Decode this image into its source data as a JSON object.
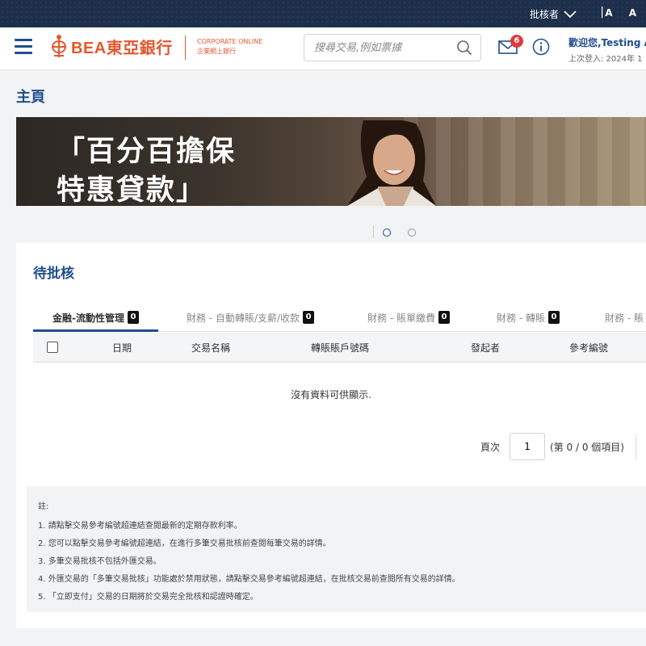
{
  "topbar": {
    "role": "批核者",
    "separator": "|",
    "font_sizes": "A A"
  },
  "header": {
    "logo_text": "BEA東亞銀行",
    "corp_line1": "CORPORATE ONLINE",
    "corp_line2": "企業網上銀行",
    "search_placeholder": "搜尋交易,例如票據",
    "mail_badge": "6",
    "welcome": "歡迎您,Testing AI",
    "last_login": "上次登入: 2024年 1"
  },
  "page": {
    "title": "主頁"
  },
  "banner": {
    "line1": "「百分百擔保",
    "line2": "特惠貸款」",
    "slides": 2,
    "active_slide": 1
  },
  "pending": {
    "title": "待批核",
    "tabs": [
      {
        "label": "金融-流動性管理",
        "count": "0"
      },
      {
        "label": "財務 - 自動轉賬/支薪/收款",
        "count": "0"
      },
      {
        "label": "財務 - 賬單繳費",
        "count": "0"
      },
      {
        "label": "財務 - 轉賬",
        "count": "0"
      },
      {
        "label": "財務 - 賬",
        "count": ""
      }
    ],
    "columns": [
      "日期",
      "交易名稱",
      "轉賬賬戶號碼",
      "發起者",
      "參考編號"
    ],
    "empty_text": "沒有資料可供顯示.",
    "pager": {
      "label": "頁次",
      "page": "1",
      "summary": "(第 0 / 0 個項目)",
      "first": "K"
    }
  },
  "notes": {
    "heading": "註:",
    "items": [
      "1. 請點擊交易參考編號超連結查閱最新的定期存款利率。",
      "2. 您可以點擊交易參考編號超連結，在進行多筆交易批核前查閱每筆交易的詳情。",
      "3. 多筆交易批核不包括外匯交易。",
      "4. 外匯交易的「多筆交易批核」功能處於禁用狀態，請點擊交易參考編號超連結，在批核交易前查閱所有交易的詳情。",
      "5. 「立即支付」交易的日期將於交易完全批核和認證時確定。"
    ]
  },
  "colors": {
    "brand_red": "#e4572e",
    "brand_blue": "#1f4e8c",
    "topbar": "#1d2f4a",
    "badge": "#e03a3e"
  }
}
